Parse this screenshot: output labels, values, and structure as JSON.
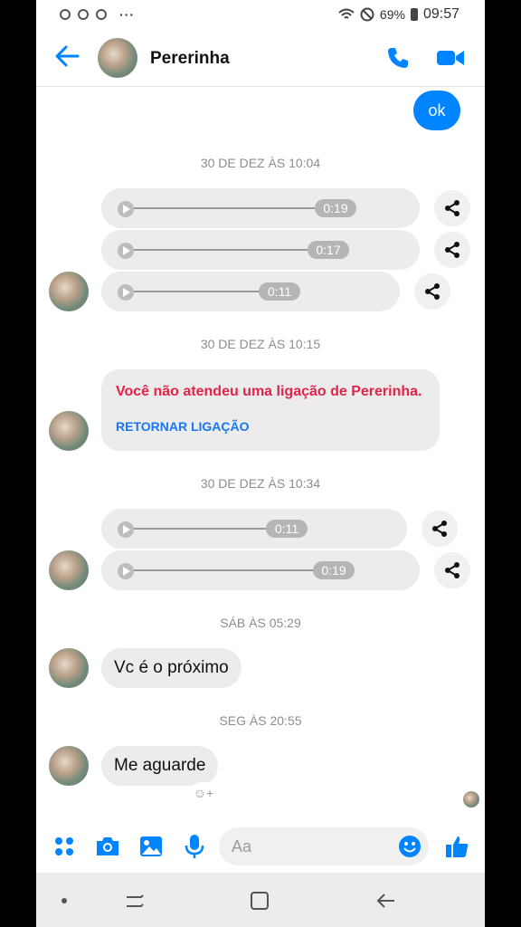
{
  "status": {
    "more": "···",
    "battery": "69%",
    "time": "09:57"
  },
  "header": {
    "title": "Pererinha"
  },
  "messages": {
    "sent_ok": "ok",
    "ts1": "30 DE DEZ ÀS 10:04",
    "audio1": "0:19",
    "audio2": "0:17",
    "audio3": "0:11",
    "ts2": "30 DE DEZ ÀS 10:15",
    "missed_call": "Você não atendeu uma ligação de Pererinha.",
    "callback": "RETORNAR LIGAÇÃO",
    "ts3": "30 DE DEZ ÀS 10:34",
    "audio4": "0:11",
    "audio5": "0:19",
    "ts4": "SÁB ÀS 05:29",
    "text1": "Vc é o próximo",
    "ts5": "SEG ÀS 20:55",
    "text2": "Me aguarde",
    "react_add": "☺+"
  },
  "composer": {
    "placeholder": "Aa"
  },
  "colors": {
    "accent": "#0084ff",
    "missed": "#e0244a",
    "link": "#1877f2"
  }
}
